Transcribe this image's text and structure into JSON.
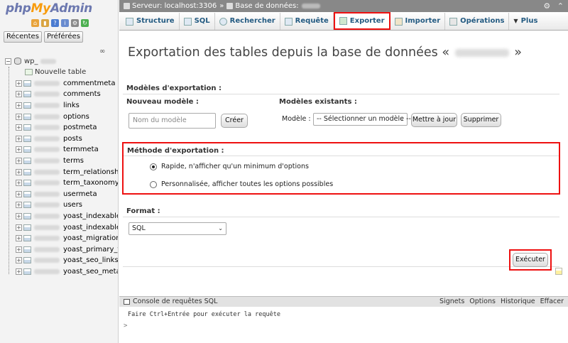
{
  "nav": {
    "logo": {
      "php": "php",
      "my": "My",
      "admin": "Admin"
    },
    "tabs": [
      "Récentes",
      "Préférées"
    ],
    "db": {
      "name": "wp_"
    },
    "new_table": "Nouvelle table",
    "tables": [
      "commentmeta",
      "comments",
      "links",
      "options",
      "postmeta",
      "posts",
      "termmeta",
      "terms",
      "term_relationships",
      "term_taxonomy",
      "usermeta",
      "users",
      "yoast_indexable",
      "yoast_indexable_h",
      "yoast_migrations",
      "yoast_primary_ten",
      "yoast_seo_links",
      "yoast_seo_meta"
    ]
  },
  "breadcrumb": {
    "server": "Serveur: localhost:3306",
    "separator": "»",
    "database": "Base de données:"
  },
  "tabs": [
    {
      "label": "Structure"
    },
    {
      "label": "SQL"
    },
    {
      "label": "Rechercher"
    },
    {
      "label": "Requête"
    },
    {
      "label": "Exporter"
    },
    {
      "label": "Importer"
    },
    {
      "label": "Opérations"
    },
    {
      "label": "Plus"
    }
  ],
  "page": {
    "title_prefix": "Exportation des tables depuis la base de données «",
    "title_suffix": "»"
  },
  "modeles": {
    "legend": "Modèles d'exportation :",
    "nouveau_label": "Nouveau modèle :",
    "nouveau_placeholder": "Nom du modèle",
    "creer": "Créer",
    "existants_label": "Modèles existants :",
    "modele_label": "Modèle :",
    "select_value": "-- Sélectionner un modèle --",
    "update": "Mettre à jour",
    "delete": "Supprimer"
  },
  "methode": {
    "legend": "Méthode d'exportation :",
    "options": [
      {
        "label": "Rapide, n'afficher qu'un minimum d'options",
        "checked": true
      },
      {
        "label": "Personnalisée, afficher toutes les options possibles",
        "checked": false
      }
    ]
  },
  "format": {
    "legend": "Format :",
    "value": "SQL"
  },
  "execute": "Exécuter",
  "console": {
    "title": "Console de requêtes SQL",
    "links": [
      "Signets",
      "Options",
      "Historique",
      "Effacer"
    ],
    "message": "Faire Ctrl+Entrée pour exécuter la requête",
    "prompt": ">"
  },
  "colors": {
    "highlight": "#ee1111",
    "link": "#235a81",
    "breadcrumb_bg": "#888888"
  }
}
